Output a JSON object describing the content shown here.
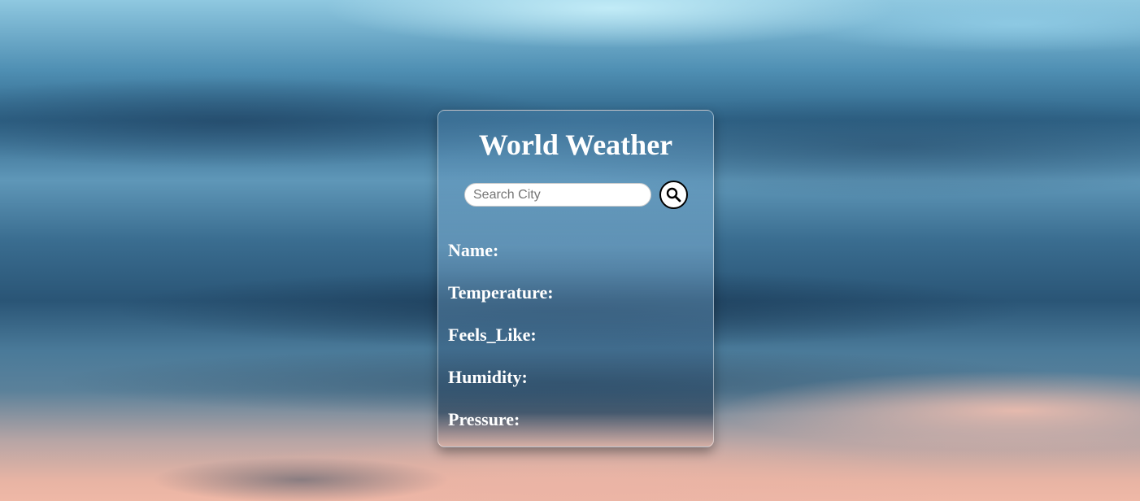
{
  "app": {
    "title": "World Weather"
  },
  "search": {
    "value": "",
    "placeholder": "Search City",
    "icon": "search-icon"
  },
  "fields": {
    "name": "Name:",
    "temperature": "Temperature:",
    "feels_like": "Feels_Like:",
    "humidity": "Humidity:",
    "pressure": "Pressure:"
  }
}
